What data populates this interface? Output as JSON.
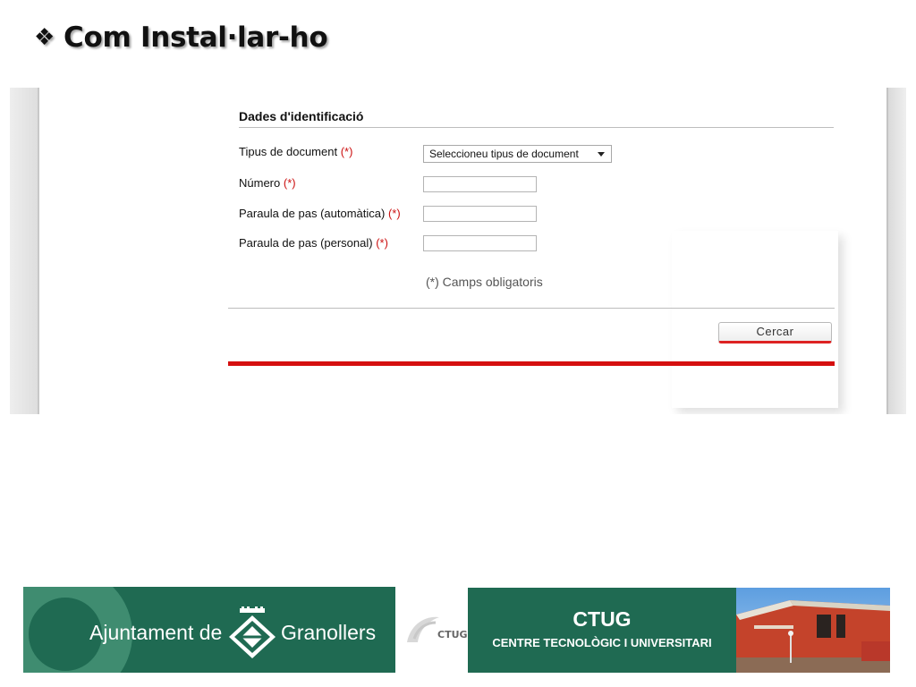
{
  "slide": {
    "bullet": "❖",
    "title": "Com Instal·lar-ho"
  },
  "form": {
    "header": "Dades d'identificació",
    "fields": [
      {
        "label": "Tipus de document",
        "required_mark": "(*)",
        "value": "Seleccioneu tipus de document"
      },
      {
        "label": "Número",
        "required_mark": "(*)",
        "value": ""
      },
      {
        "label": "Paraula de pas (automàtica)",
        "required_mark": "(*)",
        "value": ""
      },
      {
        "label": "Paraula de pas (personal)",
        "required_mark": "(*)",
        "value": ""
      }
    ],
    "note": "(*) Camps obligatoris",
    "search_button": "Cercar"
  },
  "footer": {
    "ajuntament": {
      "left_text": "Ajuntament de",
      "right_text": "Granollers"
    },
    "small_logo_text": "CTUG",
    "ctug": {
      "title": "CTUG",
      "subtitle": "CENTRE TECNOLÒGIC I UNIVERSITARI"
    }
  },
  "colors": {
    "required": "#cc1111",
    "accent_red": "#d50f0f",
    "banner_green": "#1f6a52"
  }
}
